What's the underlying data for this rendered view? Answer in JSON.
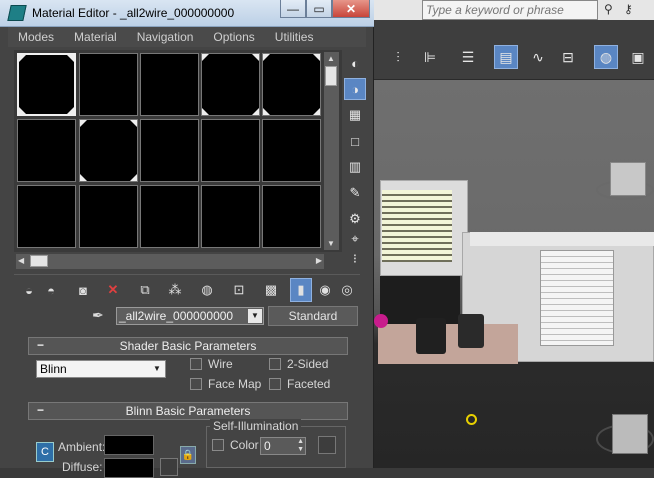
{
  "window": {
    "title": "Material Editor - _all2wire_000000000",
    "minimize": "—",
    "maximize": "▭",
    "close": "✕"
  },
  "menu": [
    "Modes",
    "Material",
    "Navigation",
    "Options",
    "Utilities"
  ],
  "background_app": {
    "search_placeholder": "Type a keyword or phrase"
  },
  "material": {
    "name": "_all2wire_000000000",
    "type_button": "Standard"
  },
  "shader_rollout": {
    "title": "Shader Basic Parameters",
    "shader": "Blinn",
    "options": [
      {
        "label": "Wire",
        "checked": false
      },
      {
        "label": "2-Sided",
        "checked": false
      },
      {
        "label": "Face Map",
        "checked": false
      },
      {
        "label": "Faceted",
        "checked": false
      }
    ]
  },
  "blinn_rollout": {
    "title": "Blinn Basic Parameters",
    "self_illumination_label": "Self-Illumination",
    "color_label": "Color",
    "color_value": "0",
    "ambient_label": "Ambient:",
    "diffuse_label": "Diffuse:"
  },
  "colors": {
    "accent": "#5a86c3",
    "titlebar": "#cfdcec",
    "panel": "#444444"
  }
}
